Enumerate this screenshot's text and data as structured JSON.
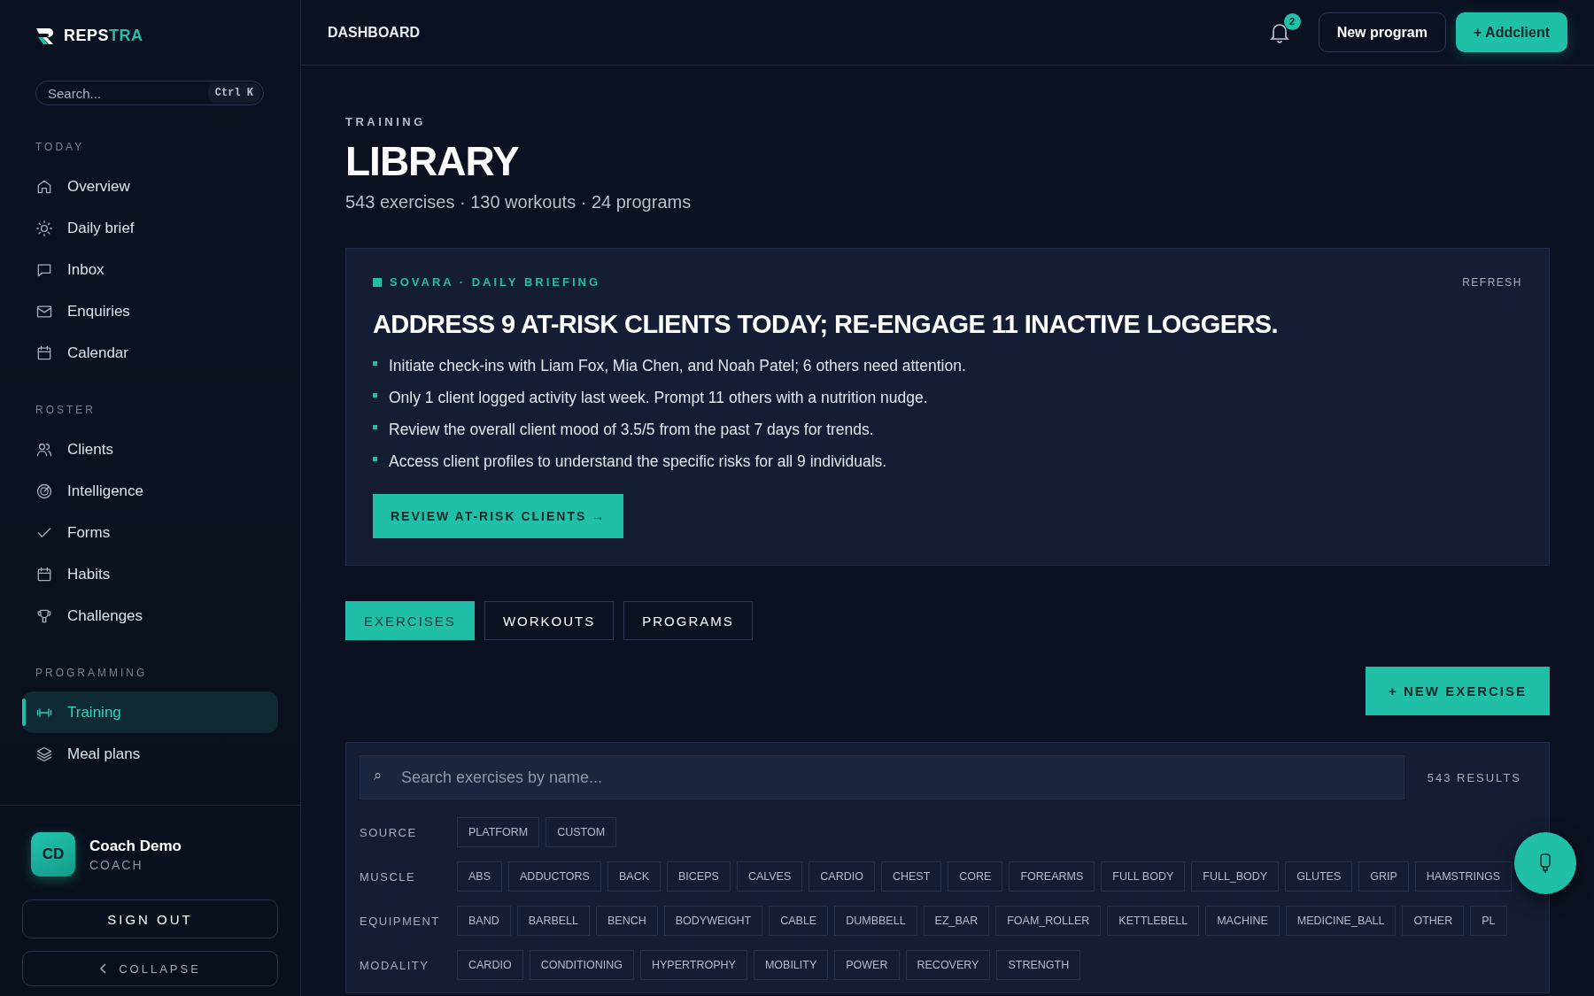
{
  "brand": {
    "name": "REPS",
    "accent": "TRA"
  },
  "sidebar": {
    "search": {
      "placeholder": "Search...",
      "shortcut": "Ctrl K"
    },
    "sections": [
      {
        "title": "TODAY",
        "items": [
          {
            "label": "Overview",
            "selected": false
          },
          {
            "label": "Daily brief",
            "selected": false
          },
          {
            "label": "Inbox",
            "selected": false
          },
          {
            "label": "Enquiries",
            "selected": false
          },
          {
            "label": "Calendar",
            "selected": false
          }
        ]
      },
      {
        "title": "ROSTER",
        "items": [
          {
            "label": "Clients",
            "selected": false
          },
          {
            "label": "Intelligence",
            "selected": false
          },
          {
            "label": "Forms",
            "selected": false
          },
          {
            "label": "Habits",
            "selected": false
          },
          {
            "label": "Challenges",
            "selected": false
          }
        ]
      },
      {
        "title": "PROGRAMMING",
        "items": [
          {
            "label": "Training",
            "selected": true
          },
          {
            "label": "Meal plans",
            "selected": false
          }
        ]
      }
    ],
    "user": {
      "initials": "CD",
      "name": "Coach Demo",
      "role": "COACH"
    },
    "sign_out": "SIGN OUT",
    "collapse": "COLLAPSE"
  },
  "header": {
    "title": "DASHBOARD",
    "notifications": "2",
    "buttons": [
      {
        "label": "New program",
        "kind": "outline"
      },
      {
        "label": "+ Addclient",
        "kind": "filled"
      }
    ]
  },
  "page": {
    "eyebrow": "TRAINING",
    "title": "LIBRARY",
    "summary": "543 exercises · 130 workouts · 24 programs"
  },
  "briefing": {
    "eyebrow": "SOVARA · DAILY BRIEFING",
    "refresh": "REFRESH",
    "headline": "ADDRESS 9 AT-RISK CLIENTS TODAY; RE-ENGAGE 11 INACTIVE LOGGERS.",
    "bullets": [
      "Initiate check-ins with Liam Fox, Mia Chen, and Noah Patel; 6 others need attention.",
      "Only 1 client logged activity last week. Prompt 11 others with a nutrition nudge.",
      "Review the overall client mood of 3.5/5 from the past 7 days for trends.",
      "Access client profiles to understand the specific risks for all 9 individuals."
    ],
    "action": "REVIEW AT-RISK CLIENTS →"
  },
  "tabs": [
    {
      "label": "EXERCISES",
      "selected": true
    },
    {
      "label": "WORKOUTS",
      "selected": false
    },
    {
      "label": "PROGRAMS",
      "selected": false
    }
  ],
  "new_exercise": "+ NEW EXERCISE",
  "filters": {
    "search": {
      "icon": "⌕",
      "placeholder": "Search exercises by name..."
    },
    "results": "543 RESULTS",
    "groups": [
      {
        "label": "SOURCE",
        "options": [
          "PLATFORM",
          "CUSTOM"
        ]
      },
      {
        "label": "MUSCLE",
        "options": [
          "ABS",
          "ADDUCTORS",
          "BACK",
          "BICEPS",
          "CALVES",
          "CARDIO",
          "CHEST",
          "CORE",
          "FOREARMS",
          "FULL BODY",
          "FULL_BODY",
          "GLUTES",
          "GRIP",
          "HAMSTRINGS"
        ]
      },
      {
        "label": "EQUIPMENT",
        "options": [
          "BAND",
          "BARBELL",
          "BENCH",
          "BODYWEIGHT",
          "CABLE",
          "DUMBBELL",
          "EZ_BAR",
          "FOAM_ROLLER",
          "KETTLEBELL",
          "MACHINE",
          "MEDICINE_BALL",
          "OTHER",
          "PL"
        ]
      },
      {
        "label": "MODALITY",
        "options": [
          "CARDIO",
          "CONDITIONING",
          "HYPERTROPHY",
          "MOBILITY",
          "POWER",
          "RECOVERY",
          "STRENGTH"
        ]
      }
    ]
  }
}
